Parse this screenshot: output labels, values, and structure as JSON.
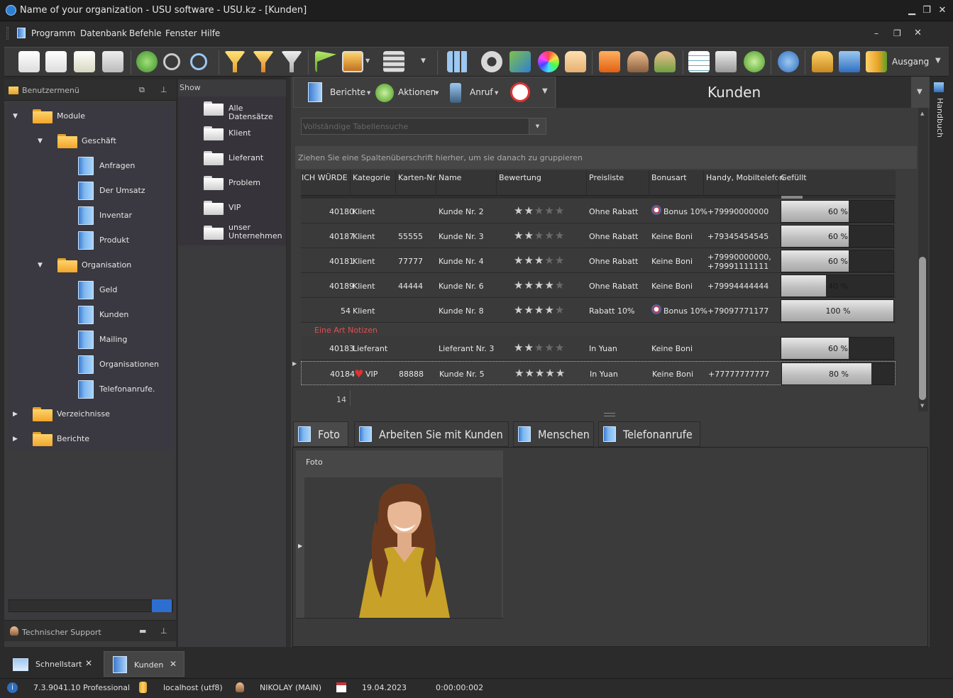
{
  "window": {
    "title": "Name of your organization - USU software - USU.kz - [Kunden]"
  },
  "menu": [
    "Programm",
    "Datenbank",
    "Befehle",
    "Fenster",
    "Hilfe"
  ],
  "toolbar": {
    "exit_label": "Ausgang"
  },
  "left_panel": {
    "title": "Benutzermenü",
    "tree": [
      {
        "label": "Module",
        "level": 0,
        "type": "folder",
        "expanded": true
      },
      {
        "label": "Geschäft",
        "level": 1,
        "type": "folder",
        "expanded": true
      },
      {
        "label": "Anfragen",
        "level": 2,
        "type": "doc"
      },
      {
        "label": "Der Umsatz",
        "level": 2,
        "type": "doc"
      },
      {
        "label": "Inventar",
        "level": 2,
        "type": "doc"
      },
      {
        "label": "Produkt",
        "level": 2,
        "type": "doc"
      },
      {
        "label": "Organisation",
        "level": 1,
        "type": "folder",
        "expanded": true
      },
      {
        "label": "Geld",
        "level": 2,
        "type": "doc"
      },
      {
        "label": "Kunden",
        "level": 2,
        "type": "doc"
      },
      {
        "label": "Mailing",
        "level": 2,
        "type": "doc"
      },
      {
        "label": "Organisationen",
        "level": 2,
        "type": "doc"
      },
      {
        "label": "Telefonanrufe.",
        "level": 2,
        "type": "doc"
      },
      {
        "label": "Verzeichnisse",
        "level": 0,
        "type": "folder",
        "expanded": false
      },
      {
        "label": "Berichte",
        "level": 0,
        "type": "folder",
        "expanded": false
      }
    ],
    "support_title": "Technischer Support"
  },
  "show_panel": {
    "title": "Show",
    "items": [
      "Alle Datensätze",
      "Klient",
      "Lieferant",
      "Problem",
      "VIP",
      "unser Unternehmen"
    ]
  },
  "main": {
    "title": "Kunden",
    "actions": {
      "reports": "Berichte",
      "actions": "Aktionen",
      "call": "Anruf"
    },
    "search_placeholder": "Vollständige Tabellensuche",
    "group_hint": "Ziehen Sie eine Spaltenüberschrift hierher, um sie danach zu gruppieren",
    "columns": [
      "ICH WÜRDE",
      "Kategorie",
      "Karten-Nr.",
      "Name",
      "Bewertung",
      "Preisliste",
      "Bonusart",
      "Handy, Mobiltelefon",
      "Gefüllt"
    ],
    "rows": [
      {
        "id": "40180",
        "category": "Klient",
        "card": "",
        "name": "Kunde Nr. 2",
        "rating": 2,
        "price": "Ohne Rabatt",
        "bonus": "Bonus 10%",
        "bonus_icon": true,
        "phone": "+79990000000",
        "filled": 60,
        "filled_label": "60 %"
      },
      {
        "id": "40187",
        "category": "Klient",
        "card": "55555",
        "name": "Kunde Nr. 3",
        "rating": 2,
        "price": "Ohne Rabatt",
        "bonus": "Keine Boni",
        "bonus_icon": false,
        "phone": "+79345454545",
        "filled": 60,
        "filled_label": "60 %"
      },
      {
        "id": "40181",
        "category": "Klient",
        "card": "77777",
        "name": "Kunde Nr. 4",
        "rating": 3,
        "price": "Ohne Rabatt",
        "bonus": "Keine Boni",
        "bonus_icon": false,
        "phone": "+79990000000,",
        "phone2": "+79991111111",
        "filled": 60,
        "filled_label": "60 %"
      },
      {
        "id": "40189",
        "category": "Klient",
        "card": "44444",
        "name": "Kunde Nr. 6",
        "rating": 4,
        "price": "Ohne Rabatt",
        "bonus": "Keine Boni",
        "bonus_icon": false,
        "phone": "+79994444444",
        "filled": 40,
        "filled_label": "40 %"
      },
      {
        "id": "54",
        "category": "Klient",
        "card": "",
        "name": "Kunde Nr. 8",
        "rating": 4,
        "price": "Rabatt 10%",
        "bonus": "Bonus 10%",
        "bonus_icon": true,
        "phone": "+79097771177",
        "filled": 100,
        "filled_label": "100 %"
      }
    ],
    "group_label": "Eine Art Notizen",
    "rows2": [
      {
        "id": "40183",
        "category": "Lieferant",
        "card": "",
        "name": "Lieferant Nr. 3",
        "rating": 2,
        "price": "In Yuan",
        "bonus": "Keine Boni",
        "bonus_icon": false,
        "phone": "",
        "filled": 60,
        "filled_label": "60 %"
      },
      {
        "id": "40184",
        "category": "VIP",
        "heart": true,
        "card": "88888",
        "name": "Kunde Nr. 5",
        "rating": 5,
        "price": "In Yuan",
        "bonus": "Keine Boni",
        "bonus_icon": false,
        "phone": "+77777777777",
        "filled": 80,
        "filled_label": "80 %"
      }
    ],
    "record_count": "14",
    "tabs": [
      "Foto",
      "Arbeiten Sie mit Kunden",
      "Menschen",
      "Telefonanrufe"
    ],
    "photo_header": "Foto"
  },
  "side_tab": "Handbuch",
  "taskbar": {
    "items": [
      "Schnellstart",
      "Kunden"
    ]
  },
  "status": {
    "version": "7.3.9041.10 Professional",
    "db": "localhost (utf8)",
    "user": "NIKOLAY (MAIN)",
    "date": "19.04.2023",
    "timer": "0:00:00:002"
  },
  "colors": {
    "accent_red": "#e05050",
    "bg": "#2b2b2b"
  }
}
